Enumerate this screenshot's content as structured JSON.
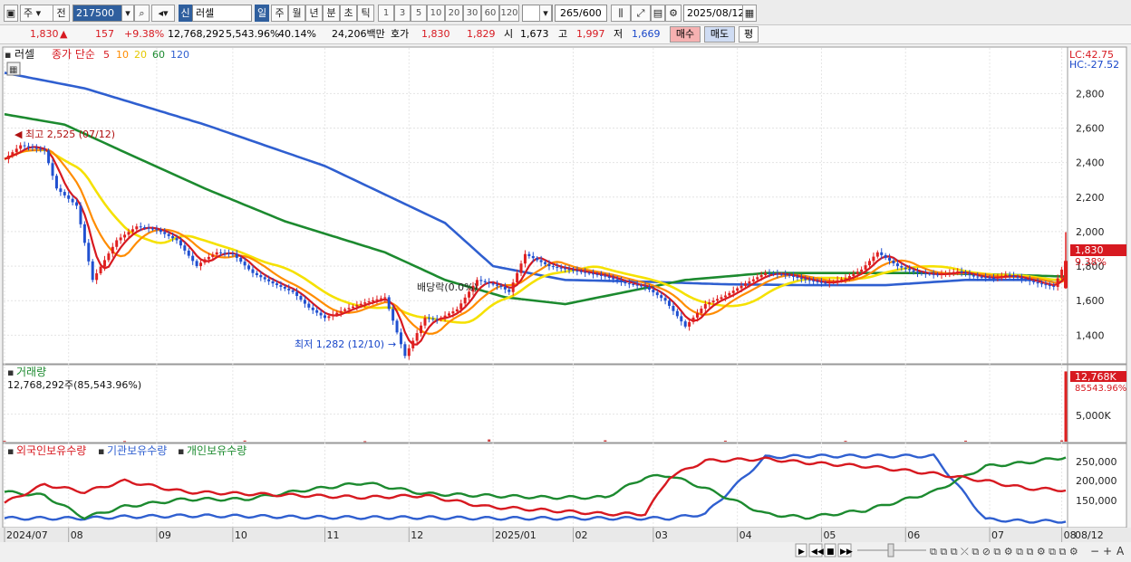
{
  "toolbar": {
    "period_type": "주",
    "prev_label": "전",
    "stock_code": "217500",
    "credit_badge": "신",
    "stock_name": "러셀",
    "periods": [
      "일",
      "주",
      "월",
      "년",
      "분",
      "초",
      "틱"
    ],
    "selected_period": "일",
    "intervals": [
      "1",
      "3",
      "5",
      "10",
      "20",
      "30",
      "60",
      "120"
    ],
    "count": "265",
    "count_total": "/600",
    "date": "2025/08/12"
  },
  "quote": {
    "price": "1,830",
    "arrow": "▲",
    "change": "157",
    "change_pct": "+9.38%",
    "volume": "12,768,292",
    "volume_ratio": "5,543.96%",
    "turnover": "40.14%",
    "amount": "24,206백만",
    "bid_label": "호가",
    "ask_price": "1,830",
    "bid_price": "1,829",
    "open_label": "시",
    "open": "1,673",
    "high_label": "고",
    "high": "1,997",
    "low_label": "저",
    "low": "1,669",
    "buy_label": "매수",
    "sell_label": "매도",
    "eval_label": "평"
  },
  "chart_data": {
    "type": "line",
    "title": "러셀",
    "ma_label": "종가 단순",
    "ma_periods": [
      "5",
      "10",
      "20",
      "60",
      "120"
    ],
    "ma_colors": [
      "#d71920",
      "#ff8c00",
      "#f5e100",
      "#1c8a2f",
      "#2f5fd0"
    ],
    "lc_label": "LC:42.75",
    "hc_label": "HC:-27.52",
    "y_ticks": [
      "2,800",
      "2,600",
      "2,400",
      "2,200",
      "2,000",
      "1,800",
      "1,600",
      "1,400"
    ],
    "ylim": [
      1250,
      2980
    ],
    "x_labels": [
      "2024/07",
      "08",
      "09",
      "10",
      "11",
      "12",
      "2025/01",
      "02",
      "03",
      "04",
      "05",
      "06",
      "07",
      "08"
    ],
    "x_end_label": "08/12",
    "price_tag": "1,830",
    "pct_tag": "9.38%",
    "high_note": "최고 2,525 (07/12)",
    "low_note": "최저 1,282 (12/10)",
    "dividend_note": "배당락(0.0%)",
    "price_x": [
      0,
      4,
      10,
      13,
      18,
      22,
      28,
      33,
      38,
      43,
      48,
      50,
      53,
      57,
      62,
      67,
      72,
      76,
      80,
      85,
      90,
      95,
      100,
      105,
      108,
      113,
      118,
      124,
      126,
      130,
      136,
      143,
      150,
      155,
      160,
      165,
      170,
      175,
      180,
      185,
      190,
      195,
      200,
      205,
      210,
      214,
      218,
      223,
      228,
      233,
      238,
      242,
      247,
      250,
      255,
      258,
      262,
      265
    ],
    "price_y": [
      2420,
      2500,
      2470,
      2250,
      2150,
      1720,
      1950,
      2030,
      2010,
      1950,
      1800,
      1840,
      1880,
      1870,
      1760,
      1700,
      1650,
      1560,
      1500,
      1550,
      1590,
      1620,
      1280,
      1500,
      1490,
      1550,
      1720,
      1680,
      1650,
      1870,
      1800,
      1770,
      1740,
      1700,
      1680,
      1600,
      1450,
      1580,
      1630,
      1700,
      1760,
      1750,
      1720,
      1700,
      1730,
      1780,
      1880,
      1800,
      1760,
      1750,
      1770,
      1740,
      1730,
      1750,
      1720,
      1700,
      1680,
      1830
    ],
    "ma120_x": [
      0,
      20,
      50,
      80,
      110,
      122,
      140,
      160,
      180,
      200,
      220,
      240,
      265
    ],
    "ma120": [
      2920,
      2830,
      2620,
      2380,
      2050,
      1800,
      1720,
      1710,
      1695,
      1690,
      1690,
      1720,
      1720
    ],
    "ma60_x": [
      0,
      15,
      30,
      50,
      70,
      95,
      110,
      125,
      140,
      155,
      170,
      190,
      210,
      230,
      250,
      265
    ],
    "ma60": [
      2680,
      2620,
      2460,
      2250,
      2060,
      1880,
      1720,
      1620,
      1580,
      1650,
      1720,
      1760,
      1760,
      1760,
      1750,
      1740
    ],
    "volume_label": "거래량",
    "volume_value": "12,768,292주(85,543.96%)",
    "volume_tag": "12,768K",
    "volume_pct_tag": "85543.96%",
    "volume_tick": "5,000K",
    "volume_ylim": [
      0,
      13000000
    ],
    "volume_x": [
      0,
      30,
      60,
      90,
      121,
      150,
      180,
      210,
      240,
      264,
      265
    ],
    "volume_values": [
      150000,
      120000,
      200000,
      100000,
      400000,
      250000,
      180000,
      150000,
      180000,
      230000,
      12768292
    ],
    "holdings_labels": [
      "외국인보유수량",
      "기관보유수량",
      "개인보유수량"
    ],
    "holdings_colors": [
      "#d71920",
      "#2f5fd0",
      "#1c8a2f"
    ],
    "holdings_ticks": [
      "250,000",
      "200,000",
      "150,000"
    ],
    "holdings_ylim": [
      80000,
      290000
    ],
    "holdings_x": [
      0,
      10,
      20,
      30,
      45,
      60,
      75,
      90,
      105,
      120,
      135,
      150,
      160,
      166,
      175,
      190,
      200,
      215,
      232,
      245,
      255,
      265
    ],
    "foreign": [
      140000,
      190000,
      170000,
      200000,
      170000,
      165000,
      160000,
      155000,
      160000,
      130000,
      120000,
      110000,
      110000,
      210000,
      255000,
      260000,
      250000,
      240000,
      220000,
      200000,
      180000,
      175000
    ],
    "institution": [
      98000,
      98000,
      98000,
      102000,
      105000,
      104000,
      101000,
      100000,
      100000,
      98000,
      98000,
      98000,
      98000,
      98000,
      110000,
      265000,
      268000,
      268000,
      268000,
      95000,
      90000,
      90000
    ],
    "individual": [
      170000,
      160000,
      100000,
      130000,
      150000,
      150000,
      175000,
      195000,
      165000,
      160000,
      155000,
      155000,
      210000,
      215000,
      180000,
      110000,
      100000,
      120000,
      170000,
      240000,
      250000,
      265000
    ]
  }
}
